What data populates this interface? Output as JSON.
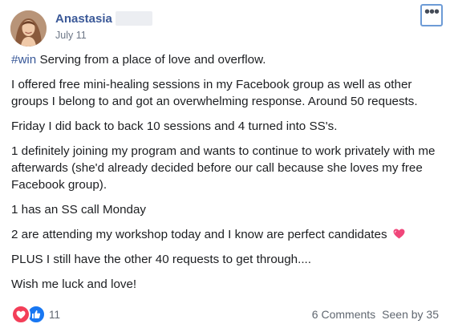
{
  "post": {
    "author_name": "Anastasia",
    "date": "July 11",
    "more_icon": "more-options-icon",
    "hashtag": "#win",
    "intro": " Serving from a place of love and overflow.",
    "paragraphs": [
      "I offered free mini-healing sessions in my Facebook group as well as other groups I belong to and got an overwhelming response. Around 50 requests.",
      "Friday I did back to back 10 sessions and 4 turned into SS's.",
      "1 definitely joining my program and wants to continue to work privately with me afterwards (she'd already decided before our call because she loves my free Facebook group).",
      "1 has an SS call Monday",
      "2 are attending my workshop today and I know are perfect candidates",
      "PLUS I still have the other 40 requests to get through....",
      "Wish me luck and love!"
    ]
  },
  "footer": {
    "reaction_icons": [
      "love-reaction-icon",
      "like-reaction-icon"
    ],
    "reaction_count": "11",
    "comments": "6 Comments",
    "seen_by": "Seen by 35"
  },
  "colors": {
    "author": "#3b5998",
    "hashtag": "#385898",
    "love": "#f33e58",
    "like": "#1877f2",
    "focus_border": "#6d9bd6"
  }
}
